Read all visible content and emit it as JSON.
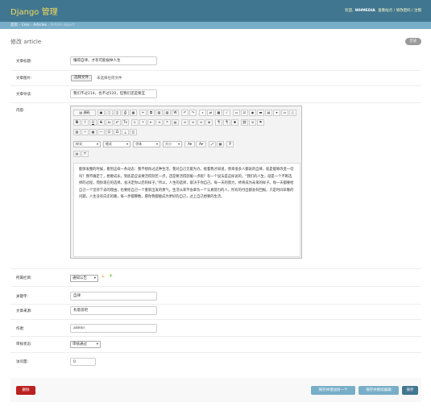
{
  "header": {
    "brand": "Django 管理",
    "welcome": "欢迎,",
    "username": "WHMEDIA",
    "view_site": "查看站点",
    "change_password": "修改密码",
    "logout": "注销",
    "sep": "/"
  },
  "breadcrumb": {
    "home": "首页",
    "app": "Cms",
    "model": "Articles",
    "current": "Article object",
    "sep": "›"
  },
  "page": {
    "title": "修改 article",
    "history": "历史"
  },
  "fields": {
    "title": {
      "label": "文章标题:",
      "value": "懂得自律，才有可能拔掉人生"
    },
    "image": {
      "label": "文章图片:",
      "button": "选择文件",
      "status": "未选择任何文件"
    },
    "intro": {
      "label": "文章导读:",
      "value": "我们不过214，也不过520，但我们还是要互"
    },
    "content": {
      "label": "内容:"
    },
    "category": {
      "label": "所属栏目:",
      "value": "通知公告"
    },
    "keywords": {
      "label": "关键字:",
      "value": "自律"
    },
    "source": {
      "label": "文章来源:",
      "value": "有意思吧"
    },
    "author": {
      "label": "作者:",
      "value": "admin"
    },
    "status": {
      "label": "审核状态:",
      "value": "审核通过"
    },
    "views": {
      "label": "访问量:",
      "value": "0"
    }
  },
  "editor": {
    "source_label": "源码",
    "styles": "样式",
    "format": "格式",
    "font": "字体",
    "size": "大小",
    "help": "?",
    "body": "能够发圈的时候，看到这样一条动态：我不想再过这种生活，我对自己无能为力。接着我才知道，原来很多人都说的自律，就是能够改变一切吗？我不确定了，想要成长，到底是应该要活得刻苦一点，还是要活得舒服一点呢？有一个说法是这样说的，“我们的人生，就是一个不断选择的过程，而你现在的选择，会决定你以后的样子。”所以，人生的选择，取决于你自己。每一天的努力，终将成为未来的样子。每一天都要给自己一个坚持下去的理由，也要给自己一个重新出发的勇气。生活从来不会辜负一个认真努力的人，所有的付出都会有回报，只是时间早晚的问题。人生没有白走的路，每一步都算数。愿你我都能成为更好的自己，过上自己想要的生活。"
  },
  "buttons": {
    "delete": "删除",
    "save_add": "保存并增加另一个",
    "save_continue": "保存并继续编辑",
    "save": "保存"
  },
  "colors": {
    "header": "#417690",
    "brand": "#f5dd5d",
    "breadcrumb": "#79aec8",
    "delete": "#ba2121",
    "save": "#79aec8",
    "save_default": "#417690"
  }
}
